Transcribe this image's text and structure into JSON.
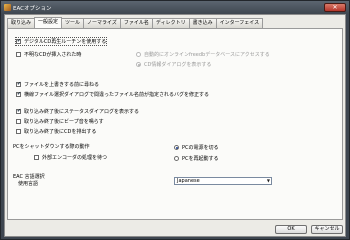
{
  "window": {
    "title": "EACオプション",
    "close_glyph": "✕"
  },
  "tabs": [
    {
      "label": "取り込み"
    },
    {
      "label": "一般設定"
    },
    {
      "label": "ツール"
    },
    {
      "label": "ノーマライズ"
    },
    {
      "label": "ファイル名"
    },
    {
      "label": "ディレクトリ"
    },
    {
      "label": "書き込み"
    },
    {
      "label": "インターフェイス"
    }
  ],
  "active_tab": "一般設定",
  "general": {
    "use_digital_cd": {
      "label": "デジタルCD再生ルーチンを使用する",
      "checked": true
    },
    "unknown_cd": {
      "label": "不明なCDが挿入された時",
      "checked": false
    },
    "auto_access_freedb": {
      "label": "自動的にオンラインfreedbデータベースにアクセスする",
      "selected": false
    },
    "show_cd_info": {
      "label": "CD情報ダイアログを表示する",
      "selected": true
    },
    "confirm_overwrite": {
      "label": "ファイルを上書きする前に尋ねる",
      "checked": true
    },
    "fix_filename_bug": {
      "label": "横線ファイル選択ダイアログで間違ったファイル名前が指定されるバグを修正する",
      "checked": true
    },
    "show_status_dialog": {
      "label": "取り込み終了後にステータスダイアログを表示する",
      "checked": true
    },
    "beep_after_rip": {
      "label": "取り込み終了後にビープ音を鳴らす",
      "checked": false
    },
    "eject_after_rip": {
      "label": "取り込み終了後にCDを排出する",
      "checked": false
    },
    "shutdown_heading": {
      "label": "PCをシャットダウンする際の動作"
    },
    "wait_external_encoder": {
      "label": "外部エンコーダの処理を待つ",
      "checked": false
    },
    "power_off": {
      "label": "PCの電源を切る",
      "selected": true
    },
    "restart_pc": {
      "label": "PCを再起動する",
      "selected": false
    },
    "language_heading": {
      "label": "EAC 言語選択"
    },
    "language_label": {
      "label": "使用言語"
    },
    "language_select": {
      "value": "Japanese"
    }
  },
  "buttons": {
    "ok": "OK",
    "cancel": "キャンセル"
  },
  "check_glyph": "✔",
  "dropdown_glyph": "▼"
}
